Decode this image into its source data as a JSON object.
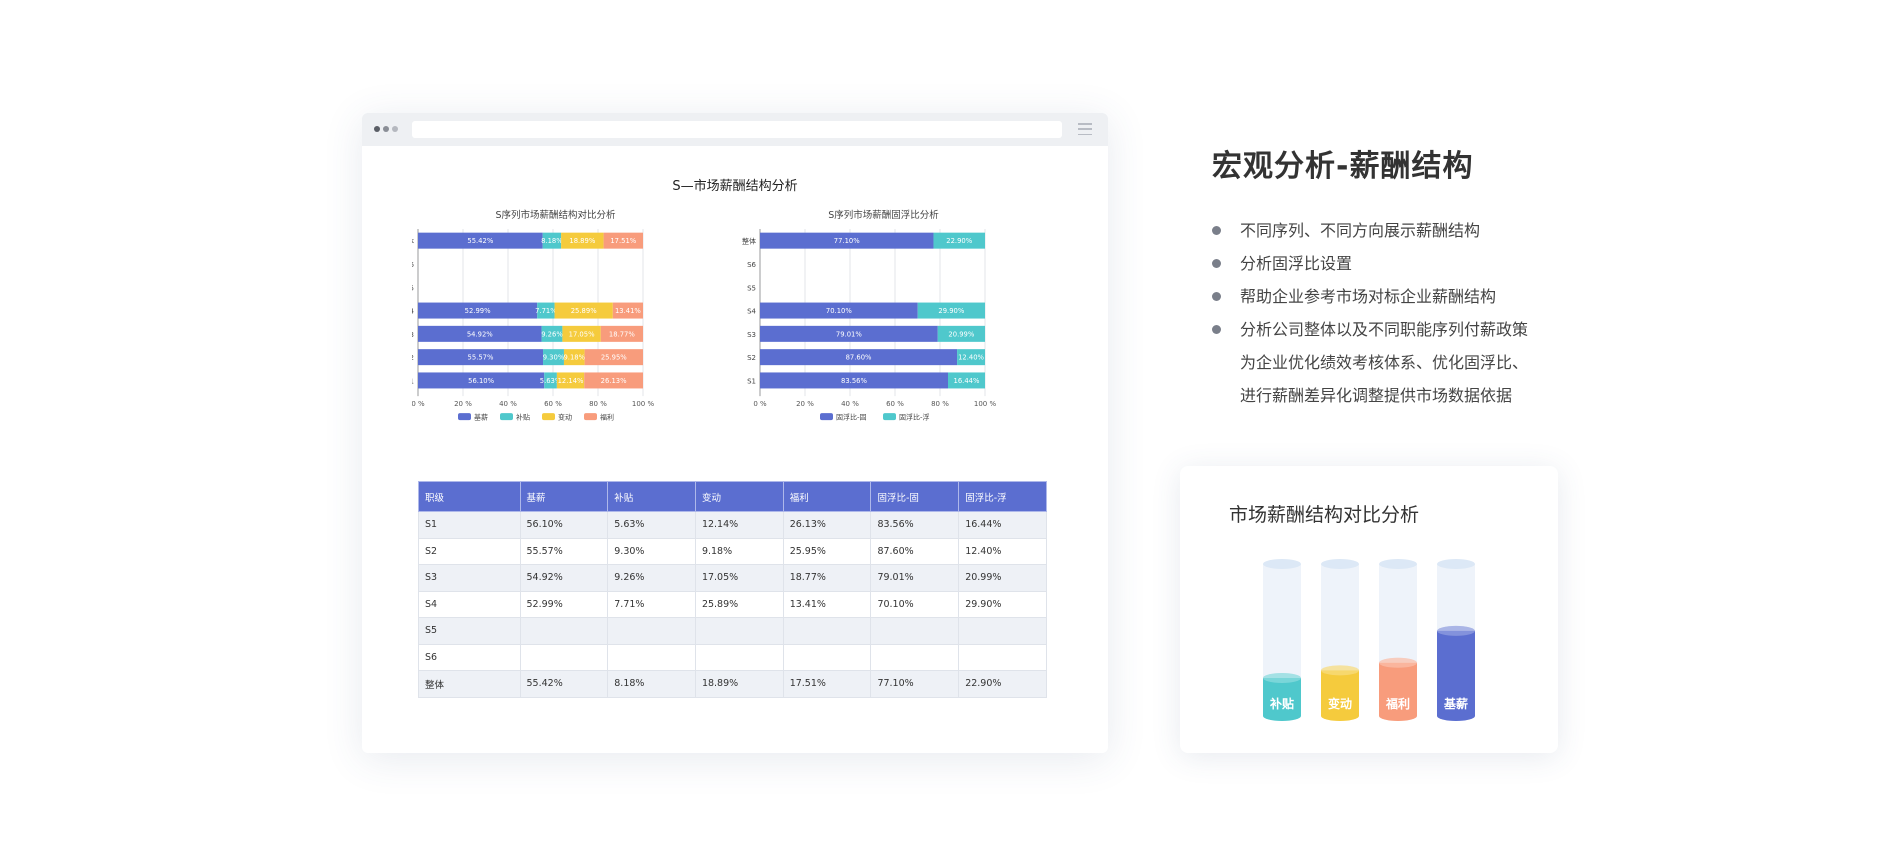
{
  "window": {
    "report_title": "S—市场薪酬结构分析"
  },
  "chart_data": [
    {
      "type": "bar",
      "stacked": "horizontal-100",
      "title": "S序列市场薪酬结构对比分析",
      "categories": [
        "整体",
        "S6",
        "S5",
        "S4",
        "S3",
        "S2",
        "S1"
      ],
      "series": [
        {
          "name": "基薪",
          "color": "#5b6ed0",
          "values": [
            55.42,
            null,
            null,
            52.99,
            54.92,
            55.57,
            56.1
          ],
          "labels": [
            "55.42%",
            "",
            "",
            "52.99%",
            "54.92%",
            "55.57%",
            "56.10%"
          ]
        },
        {
          "name": "补贴",
          "color": "#4fc8cc",
          "values": [
            8.18,
            null,
            null,
            7.71,
            9.26,
            9.3,
            5.63
          ],
          "labels": [
            "8.18%",
            "",
            "",
            "7.71%",
            "9.26%",
            "9.30%",
            "5.63%"
          ]
        },
        {
          "name": "变动",
          "color": "#f5cb3d",
          "values": [
            18.89,
            null,
            null,
            25.89,
            17.05,
            9.18,
            12.14
          ],
          "labels": [
            "18.89%",
            "",
            "",
            "25.89%",
            "17.05%",
            "9.18%",
            "12.14%"
          ]
        },
        {
          "name": "福利",
          "color": "#f89c7c",
          "values": [
            17.51,
            null,
            null,
            13.41,
            18.77,
            25.95,
            26.13
          ],
          "labels": [
            "17.51%",
            "",
            "",
            "13.41%",
            "18.77%",
            "25.95%",
            "26.13%"
          ]
        }
      ],
      "xlim": [
        0,
        100
      ],
      "xticks": [
        "0 %",
        "20 %",
        "40 %",
        "60 %",
        "80 %",
        "100 %"
      ],
      "grid": true,
      "legend": "bottom"
    },
    {
      "type": "bar",
      "stacked": "horizontal-100",
      "title": "S序列市场薪酬固浮比分析",
      "categories": [
        "整体",
        "S6",
        "S5",
        "S4",
        "S3",
        "S2",
        "S1"
      ],
      "series": [
        {
          "name": "固浮比-固",
          "color": "#5b6ed0",
          "values": [
            77.1,
            null,
            null,
            70.1,
            79.01,
            87.6,
            83.56
          ],
          "labels": [
            "77.10%",
            "",
            "",
            "70.10%",
            "79.01%",
            "87.60%",
            "83.56%"
          ]
        },
        {
          "name": "固浮比-浮",
          "color": "#4fc8cc",
          "values": [
            22.9,
            null,
            null,
            29.9,
            20.99,
            12.4,
            16.44
          ],
          "labels": [
            "22.90%",
            "",
            "",
            "29.90%",
            "20.99%",
            "12.40%",
            "16.44%"
          ]
        }
      ],
      "xlim": [
        0,
        100
      ],
      "xticks": [
        "0 %",
        "20 %",
        "40 %",
        "60 %",
        "80 %",
        "100 %"
      ],
      "grid": true,
      "legend": "bottom"
    },
    {
      "type": "bar",
      "variant": "cylinder",
      "title": "市场薪酬结构对比分析",
      "categories": [
        "补贴",
        "变动",
        "福利",
        "基薪"
      ],
      "values": [
        25,
        30,
        35,
        56
      ],
      "colors": [
        "#4fc8cc",
        "#f5cb3d",
        "#f89c7c",
        "#5b6ed0"
      ],
      "ylim": [
        0,
        100
      ]
    }
  ],
  "table": {
    "headers": [
      "职级",
      "基薪",
      "补贴",
      "变动",
      "福利",
      "固浮比-固",
      "固浮比-浮"
    ],
    "rows": [
      [
        "S1",
        "56.10%",
        "5.63%",
        "12.14%",
        "26.13%",
        "83.56%",
        "16.44%"
      ],
      [
        "S2",
        "55.57%",
        "9.30%",
        "9.18%",
        "25.95%",
        "87.60%",
        "12.40%"
      ],
      [
        "S3",
        "54.92%",
        "9.26%",
        "17.05%",
        "18.77%",
        "79.01%",
        "20.99%"
      ],
      [
        "S4",
        "52.99%",
        "7.71%",
        "25.89%",
        "13.41%",
        "70.10%",
        "29.90%"
      ],
      [
        "S5",
        "",
        "",
        "",
        "",
        "",
        ""
      ],
      [
        "S6",
        "",
        "",
        "",
        "",
        "",
        ""
      ],
      [
        "整体",
        "55.42%",
        "8.18%",
        "18.89%",
        "17.51%",
        "77.10%",
        "22.90%"
      ]
    ]
  },
  "feature": {
    "heading": "宏观分析-薪酬结构",
    "bullets": [
      {
        "lines": [
          "不同序列、不同方向展示薪酬结构"
        ]
      },
      {
        "lines": [
          "分析固浮比设置"
        ]
      },
      {
        "lines": [
          "帮助企业参考市场对标企业薪酬结构"
        ]
      },
      {
        "lines": [
          "分析公司整体以及不同职能序列付薪政策",
          "为企业优化绩效考核体系、优化固浮比、",
          "进行薪酬差异化调整提供市场数据依据"
        ]
      }
    ]
  },
  "card": {
    "title": "市场薪酬结构对比分析"
  },
  "colors": {
    "primary": "#5b6ed0",
    "teal": "#4fc8cc",
    "yellow": "#f5cb3d",
    "salmon": "#f89c7c"
  }
}
